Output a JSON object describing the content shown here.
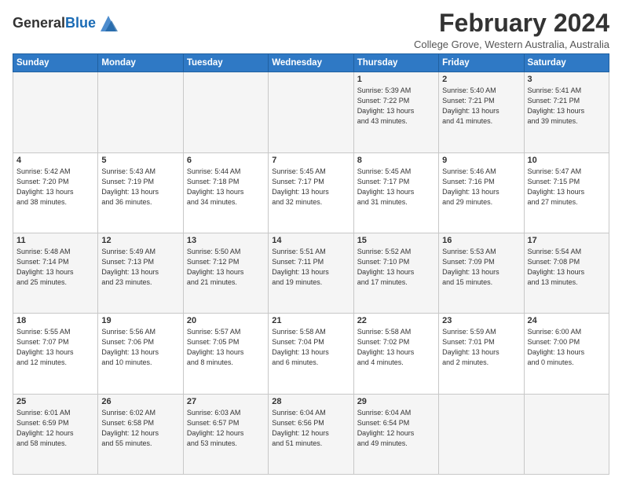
{
  "logo": {
    "general": "General",
    "blue": "Blue"
  },
  "header": {
    "month_year": "February 2024",
    "location": "College Grove, Western Australia, Australia"
  },
  "weekdays": [
    "Sunday",
    "Monday",
    "Tuesday",
    "Wednesday",
    "Thursday",
    "Friday",
    "Saturday"
  ],
  "weeks": [
    [
      {
        "day": "",
        "info": ""
      },
      {
        "day": "",
        "info": ""
      },
      {
        "day": "",
        "info": ""
      },
      {
        "day": "",
        "info": ""
      },
      {
        "day": "1",
        "info": "Sunrise: 5:39 AM\nSunset: 7:22 PM\nDaylight: 13 hours\nand 43 minutes."
      },
      {
        "day": "2",
        "info": "Sunrise: 5:40 AM\nSunset: 7:21 PM\nDaylight: 13 hours\nand 41 minutes."
      },
      {
        "day": "3",
        "info": "Sunrise: 5:41 AM\nSunset: 7:21 PM\nDaylight: 13 hours\nand 39 minutes."
      }
    ],
    [
      {
        "day": "4",
        "info": "Sunrise: 5:42 AM\nSunset: 7:20 PM\nDaylight: 13 hours\nand 38 minutes."
      },
      {
        "day": "5",
        "info": "Sunrise: 5:43 AM\nSunset: 7:19 PM\nDaylight: 13 hours\nand 36 minutes."
      },
      {
        "day": "6",
        "info": "Sunrise: 5:44 AM\nSunset: 7:18 PM\nDaylight: 13 hours\nand 34 minutes."
      },
      {
        "day": "7",
        "info": "Sunrise: 5:45 AM\nSunset: 7:17 PM\nDaylight: 13 hours\nand 32 minutes."
      },
      {
        "day": "8",
        "info": "Sunrise: 5:45 AM\nSunset: 7:17 PM\nDaylight: 13 hours\nand 31 minutes."
      },
      {
        "day": "9",
        "info": "Sunrise: 5:46 AM\nSunset: 7:16 PM\nDaylight: 13 hours\nand 29 minutes."
      },
      {
        "day": "10",
        "info": "Sunrise: 5:47 AM\nSunset: 7:15 PM\nDaylight: 13 hours\nand 27 minutes."
      }
    ],
    [
      {
        "day": "11",
        "info": "Sunrise: 5:48 AM\nSunset: 7:14 PM\nDaylight: 13 hours\nand 25 minutes."
      },
      {
        "day": "12",
        "info": "Sunrise: 5:49 AM\nSunset: 7:13 PM\nDaylight: 13 hours\nand 23 minutes."
      },
      {
        "day": "13",
        "info": "Sunrise: 5:50 AM\nSunset: 7:12 PM\nDaylight: 13 hours\nand 21 minutes."
      },
      {
        "day": "14",
        "info": "Sunrise: 5:51 AM\nSunset: 7:11 PM\nDaylight: 13 hours\nand 19 minutes."
      },
      {
        "day": "15",
        "info": "Sunrise: 5:52 AM\nSunset: 7:10 PM\nDaylight: 13 hours\nand 17 minutes."
      },
      {
        "day": "16",
        "info": "Sunrise: 5:53 AM\nSunset: 7:09 PM\nDaylight: 13 hours\nand 15 minutes."
      },
      {
        "day": "17",
        "info": "Sunrise: 5:54 AM\nSunset: 7:08 PM\nDaylight: 13 hours\nand 13 minutes."
      }
    ],
    [
      {
        "day": "18",
        "info": "Sunrise: 5:55 AM\nSunset: 7:07 PM\nDaylight: 13 hours\nand 12 minutes."
      },
      {
        "day": "19",
        "info": "Sunrise: 5:56 AM\nSunset: 7:06 PM\nDaylight: 13 hours\nand 10 minutes."
      },
      {
        "day": "20",
        "info": "Sunrise: 5:57 AM\nSunset: 7:05 PM\nDaylight: 13 hours\nand 8 minutes."
      },
      {
        "day": "21",
        "info": "Sunrise: 5:58 AM\nSunset: 7:04 PM\nDaylight: 13 hours\nand 6 minutes."
      },
      {
        "day": "22",
        "info": "Sunrise: 5:58 AM\nSunset: 7:02 PM\nDaylight: 13 hours\nand 4 minutes."
      },
      {
        "day": "23",
        "info": "Sunrise: 5:59 AM\nSunset: 7:01 PM\nDaylight: 13 hours\nand 2 minutes."
      },
      {
        "day": "24",
        "info": "Sunrise: 6:00 AM\nSunset: 7:00 PM\nDaylight: 13 hours\nand 0 minutes."
      }
    ],
    [
      {
        "day": "25",
        "info": "Sunrise: 6:01 AM\nSunset: 6:59 PM\nDaylight: 12 hours\nand 58 minutes."
      },
      {
        "day": "26",
        "info": "Sunrise: 6:02 AM\nSunset: 6:58 PM\nDaylight: 12 hours\nand 55 minutes."
      },
      {
        "day": "27",
        "info": "Sunrise: 6:03 AM\nSunset: 6:57 PM\nDaylight: 12 hours\nand 53 minutes."
      },
      {
        "day": "28",
        "info": "Sunrise: 6:04 AM\nSunset: 6:56 PM\nDaylight: 12 hours\nand 51 minutes."
      },
      {
        "day": "29",
        "info": "Sunrise: 6:04 AM\nSunset: 6:54 PM\nDaylight: 12 hours\nand 49 minutes."
      },
      {
        "day": "",
        "info": ""
      },
      {
        "day": "",
        "info": ""
      }
    ]
  ]
}
